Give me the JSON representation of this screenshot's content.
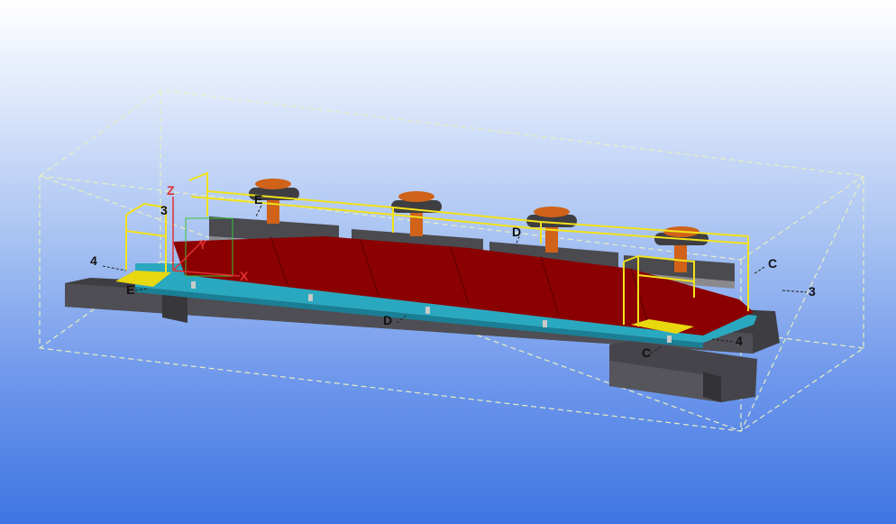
{
  "viewport": {
    "background": {
      "top": "#ffffff",
      "bottom": "#3f74e2"
    },
    "bounding_box_color": "#e8efc0"
  },
  "axis_labels": {
    "x": "X",
    "y": "Y",
    "z": "Z"
  },
  "grid_labels": {
    "e_top": "E",
    "e_left": "E",
    "d_top": "D",
    "d_bottom": "D",
    "c_right": "C",
    "c_bottom": "C",
    "three_left": "3",
    "three_right": "3",
    "four_left": "4",
    "four_right": "4"
  },
  "colors": {
    "deck": "#8b0000",
    "frame": "#2aa8c0",
    "concrete": "#4a4a4f",
    "railing": "#f2e21a",
    "bollard": "#d0621a"
  }
}
